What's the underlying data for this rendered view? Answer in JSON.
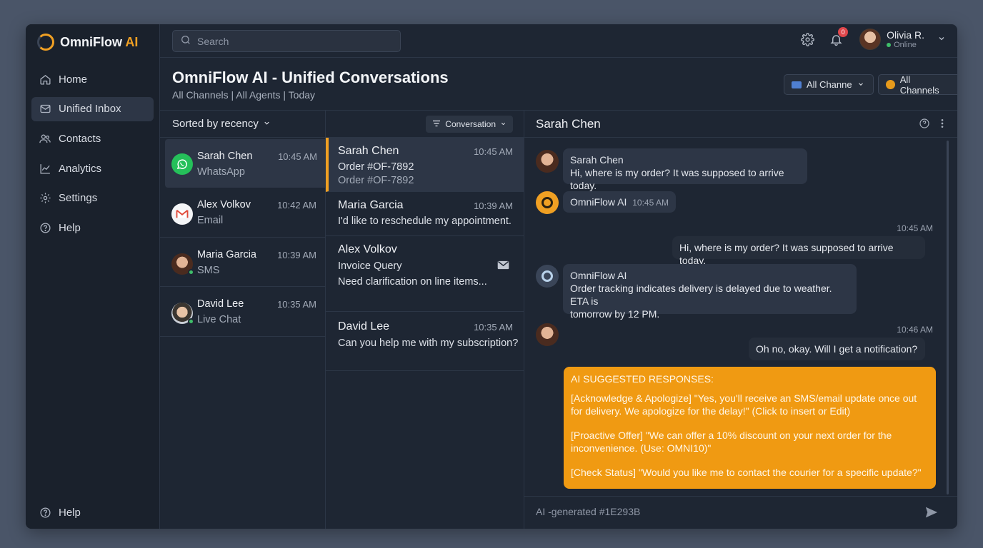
{
  "app": {
    "brand": "OmniFlow",
    "brand_ai": "AI"
  },
  "sidebar": {
    "items": [
      {
        "label": "Home",
        "icon": "home-icon"
      },
      {
        "label": "Unified Inbox",
        "icon": "inbox-icon"
      },
      {
        "label": "Contacts",
        "icon": "contacts-icon"
      },
      {
        "label": "Analytics",
        "icon": "analytics-icon"
      },
      {
        "label": "Settings",
        "icon": "gear-icon"
      },
      {
        "label": "Help",
        "icon": "help-icon"
      }
    ],
    "bottom_help": "Help"
  },
  "topbar": {
    "search_placeholder": "Search",
    "notification_count": "0",
    "user_name": "Olivia R.",
    "user_status": "Online"
  },
  "header": {
    "title": "OmniFlow AI - Unified Conversations",
    "subtitle": "All Channels | All Agents | Today",
    "filter1": "All Channels",
    "filter2": "All Channels"
  },
  "contacts": {
    "sort_label": "Sorted by recency",
    "items": [
      {
        "name": "Sarah Chen",
        "channel": "WhatsApp",
        "time": "10:45 AM"
      },
      {
        "name": "Alex Volkov",
        "channel": "Email",
        "time": "10:42 AM"
      },
      {
        "name": "Maria Garcia",
        "channel": "SMS",
        "time": "10:39 AM"
      },
      {
        "name": "David Lee",
        "channel": "Live Chat",
        "time": "10:35 AM"
      }
    ]
  },
  "conversations": {
    "filter_label": "Conversation",
    "items": [
      {
        "name": "Sarah Chen",
        "time": "10:45 AM",
        "line1": "Order #OF-7892",
        "line2": "Order #OF-7892"
      },
      {
        "name": "Maria Garcia",
        "time": "10:39 AM",
        "line1": "I'd like to reschedule my appointment."
      },
      {
        "name": "Alex Volkov",
        "line1": "Invoice Query",
        "line2": "Need clarification on line items..."
      },
      {
        "name": "David Lee",
        "time": "10:35 AM",
        "line1": "Can you help me with my subscription?"
      }
    ]
  },
  "chat": {
    "title": "Sarah Chen",
    "messages": [
      {
        "sender": "Sarah Chen",
        "text": "Hi, where is my order? It was supposed to arrive today."
      },
      {
        "sender": "OmniFlow AI",
        "time": "10:45 AM"
      },
      {
        "time": "10:45 AM",
        "text": "Hi, where is my order? It was supposed to arrive today."
      },
      {
        "sender": "OmniFlow AI",
        "text_line1": "Order tracking indicates delivery is delayed due to weather. ETA is",
        "text_line2": "tomorrow by 12 PM."
      },
      {
        "time": "10:46 AM",
        "text": "Oh no, okay. Will I get a notification?"
      }
    ],
    "suggestions": {
      "title": "AI SUGGESTED RESPONSES:",
      "s1": "[Acknowledge & Apologize] \"Yes, you'll receive an SMS/email update once out for delivery. We apologize for the delay!\" (Click to insert or Edit)",
      "s2": "[Proactive Offer] \"We can offer a 10% discount on your next order for the inconvenience. (Use: OMNI10)\"",
      "s3": "[Check Status] \"Would you like me to contact the courier for a specific update?\""
    },
    "input_placeholder": "AI -generated #1E293B"
  },
  "colors": {
    "accent": "#f0a023",
    "background": "#1e2633",
    "suggestion_bg": "#f09a12",
    "online": "#3fbf6a",
    "badge": "#e0474c"
  }
}
